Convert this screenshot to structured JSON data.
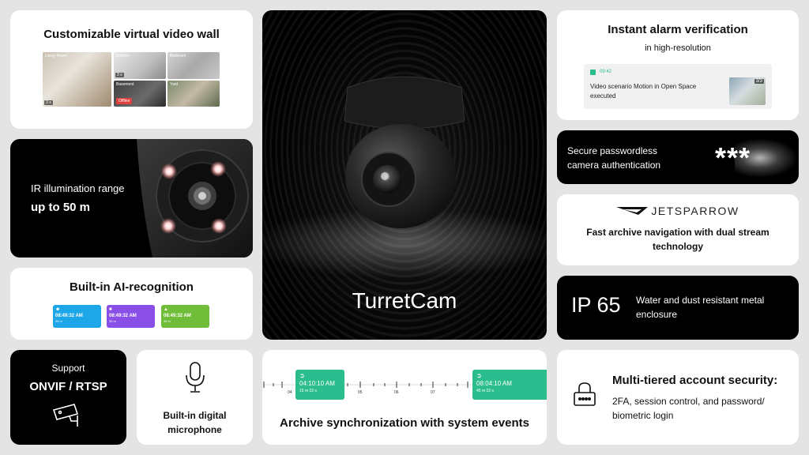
{
  "video_wall": {
    "title": "Customizable virtual video wall",
    "tiles": [
      {
        "label": "Living Room",
        "count": "3 s"
      },
      {
        "label": "Kitchen",
        "count": "3 s"
      },
      {
        "label": "Bedroom",
        "count": ""
      },
      {
        "label": "Basement",
        "tag": "Offline"
      },
      {
        "label": "Yard",
        "count": ""
      }
    ]
  },
  "ir": {
    "line1": "IR illumination range",
    "line2": "up to 50 m"
  },
  "ai": {
    "title": "Built-in AI-recognition",
    "chips": [
      {
        "time": "08:49:32 AM",
        "detail": "35 m",
        "color": "#1ea7e8"
      },
      {
        "time": "08:49:32 AM",
        "detail": "35 m",
        "color": "#8a4fe6"
      },
      {
        "time": "08:49:32 AM",
        "detail": "35 m",
        "color": "#6fbd38"
      }
    ]
  },
  "onvif": {
    "line1": "Support",
    "line2": "ONVIF / RTSP",
    "icon": "cctv-camera-icon"
  },
  "mic": {
    "line1": "Built-in digital",
    "line2": "microphone",
    "icon": "microphone-icon"
  },
  "camera": {
    "product_name": "TurretCam"
  },
  "sync": {
    "title": "Archive synchronization with system events",
    "events": [
      {
        "time": "04:10:10 AM",
        "detail": "15 m 22 s"
      },
      {
        "time": "08:04:10 AM",
        "detail": "45 m 22 s"
      }
    ],
    "ticks": [
      "04",
      "05",
      "06",
      "07"
    ],
    "accent": "#2bbd8e"
  },
  "alarm": {
    "title": "Instant alarm verification",
    "subtitle": "in high-resolution",
    "notif_time": "09:42",
    "notif_text": "Video scenario Motion in Open Space executed",
    "notif_count": "3/3"
  },
  "password": {
    "line1": "Secure passwordless",
    "line2": "camera authentication",
    "stars": "***"
  },
  "jetsparrow": {
    "brand": "JETSPARROW",
    "line1": "Fast archive navigation with dual stream",
    "line2": "technology"
  },
  "ip65": {
    "rating": "IP 65",
    "line1": "Water and dust resistant metal",
    "line2": "enclosure"
  },
  "security": {
    "title": "Multi-tiered account security:",
    "line1": "2FA, session control, and password/",
    "line2": "biometric login",
    "icon": "lock-icon"
  }
}
